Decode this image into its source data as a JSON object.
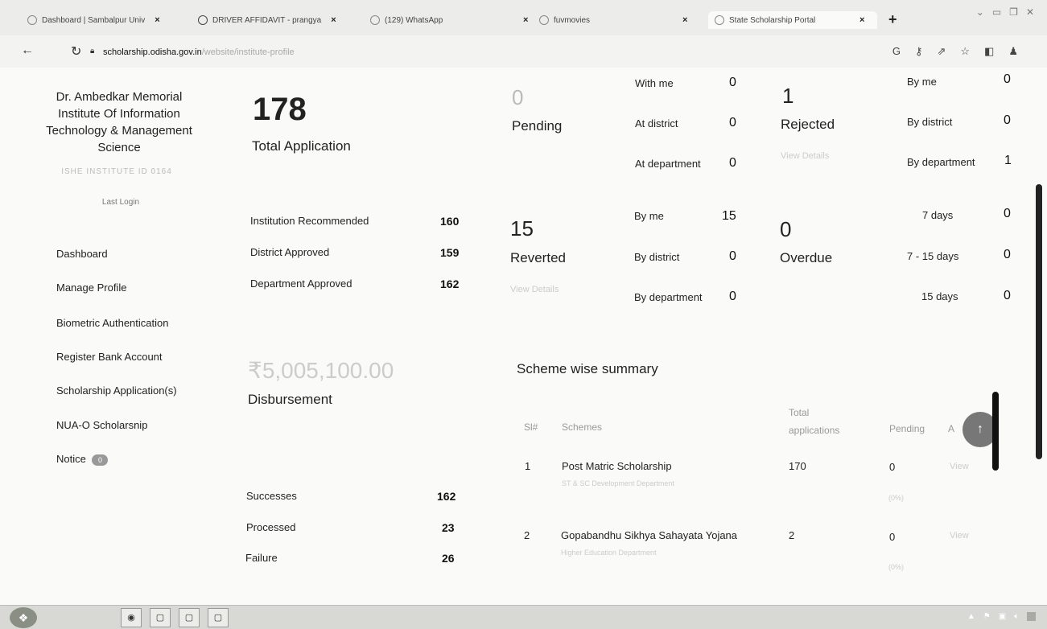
{
  "browser": {
    "tabs": [
      {
        "title": "Dashboard | Sambalpur Univ",
        "icon": "globe-icon"
      },
      {
        "title": "DRIVER AFFIDAVIT - prangya",
        "icon": "gmail-icon"
      },
      {
        "title": "(129) WhatsApp",
        "icon": "whatsapp-icon"
      },
      {
        "title": "fuvmovies",
        "icon": "globe-icon"
      },
      {
        "title": "State Scholarship Portal",
        "icon": "emblem-icon"
      }
    ],
    "close_glyph": "×",
    "new_tab": "+",
    "url_host": "scholarship.odisha.gov.in",
    "url_path": "/website/institute-profile"
  },
  "sidebar": {
    "institute_name": "Dr. Ambedkar Memorial Institute Of Information Technology & Management Science",
    "institute_code": "ISHE INSTITUTE ID 0164",
    "last_login": "Last Login",
    "menu": [
      "Dashboard",
      "Manage Profile",
      "Biometric Authentication",
      "Register Bank Account",
      "Scholarship Application(s)",
      "NUA-O Scholarsnip",
      "Notice"
    ],
    "notice_count": "0"
  },
  "summary": {
    "total_value": "178",
    "total_label": "Total Application",
    "approvals": [
      {
        "label": "Institution Recommended",
        "value": "160"
      },
      {
        "label": "District Approved",
        "value": "159"
      },
      {
        "label": "Department Approved",
        "value": "162"
      }
    ],
    "disbursement_amount": "₹5,005,100.00",
    "disbursement_label": "Disbursement",
    "payments": [
      {
        "label": "Successes",
        "value": "162"
      },
      {
        "label": "Processed",
        "value": "23"
      },
      {
        "label": "Failure",
        "value": "26"
      }
    ]
  },
  "pending": {
    "value": "0",
    "label": "Pending",
    "rows": [
      {
        "label": "With me",
        "value": "0"
      },
      {
        "label": "At district",
        "value": "0"
      },
      {
        "label": "At department",
        "value": "0"
      }
    ]
  },
  "rejected": {
    "value": "1",
    "label": "Rejected",
    "link": "View Details",
    "rows": [
      {
        "label": "By me",
        "value": "0"
      },
      {
        "label": "By district",
        "value": "0"
      },
      {
        "label": "By department",
        "value": "1"
      }
    ]
  },
  "reverted": {
    "value": "15",
    "label": "Reverted",
    "link": "View Details",
    "rows": [
      {
        "label": "By me",
        "value": "15"
      },
      {
        "label": "By district",
        "value": "0"
      },
      {
        "label": "By department",
        "value": "0"
      }
    ]
  },
  "overdue": {
    "value": "0",
    "label": "Overdue",
    "rows": [
      {
        "label": "7 days",
        "value": "0"
      },
      {
        "label": "7 - 15 days",
        "value": "0"
      },
      {
        "label": "15 days",
        "value": "0"
      }
    ]
  },
  "schemes": {
    "title": "Scheme wise summary",
    "headers": {
      "sl": "Sl#",
      "scheme": "Schemes",
      "total": "Total applications",
      "pending": "Pending",
      "action": "A"
    },
    "rows": [
      {
        "sl": "1",
        "name": "Post Matric Scholarship",
        "dept": "ST & SC Development Department",
        "total": "170",
        "pending": "0",
        "action": "View",
        "extra": "(0%)"
      },
      {
        "sl": "2",
        "name": "Gopabandhu Sikhya Sahayata Yojana",
        "dept": "Higher Education Department",
        "total": "2",
        "pending": "0",
        "action": "View",
        "extra": "(0%)"
      }
    ]
  }
}
